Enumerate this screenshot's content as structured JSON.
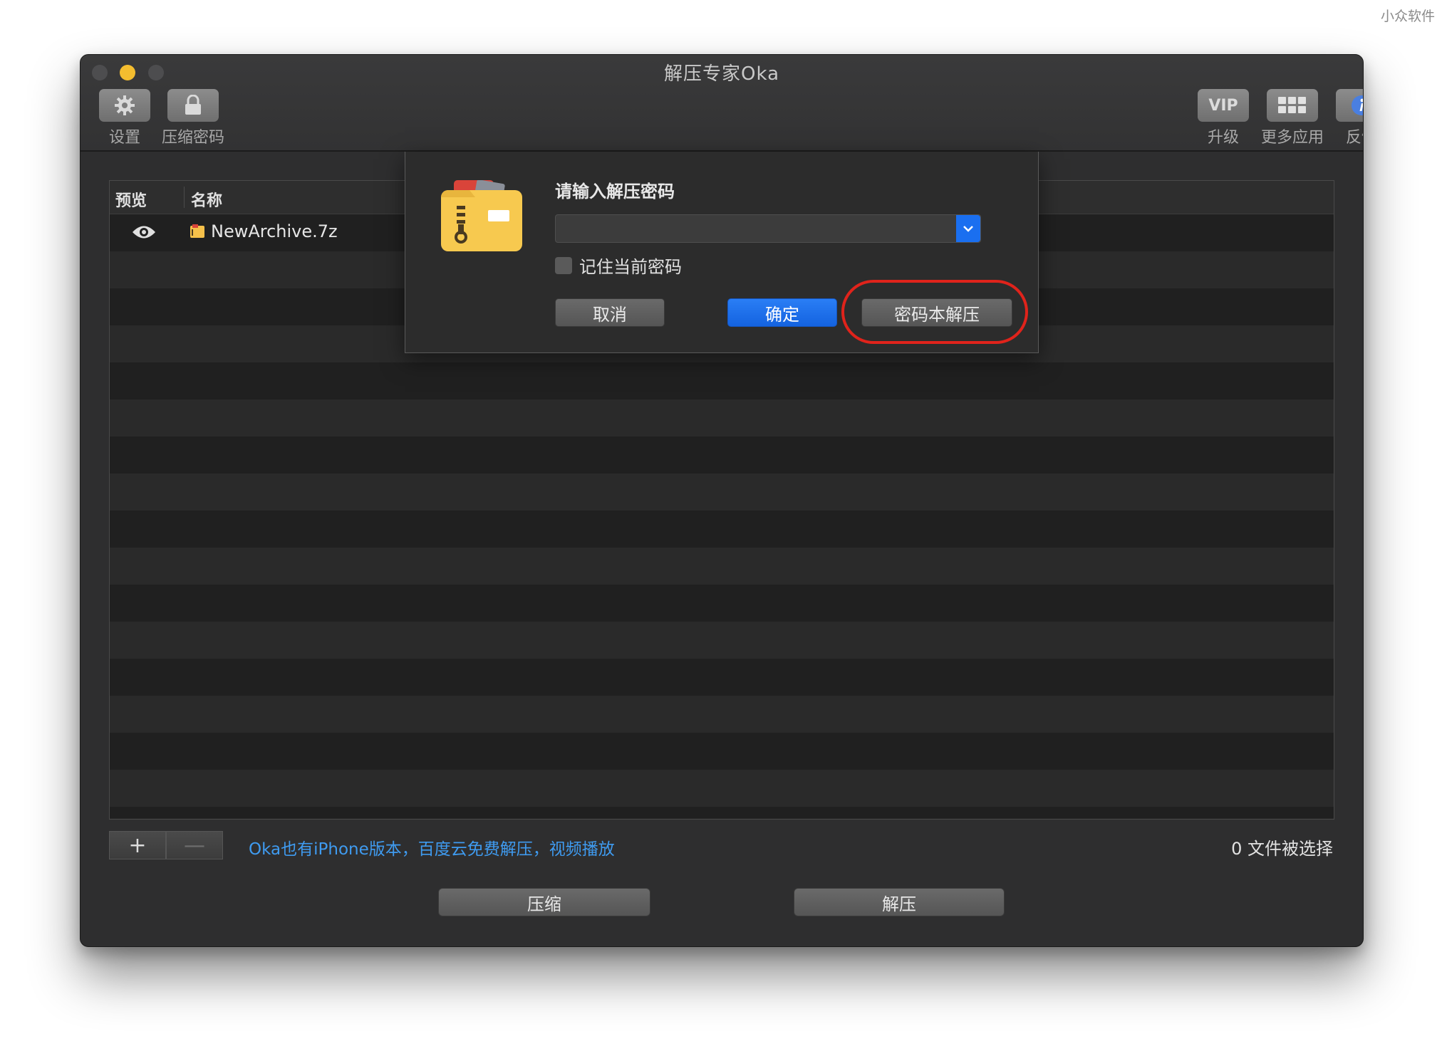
{
  "watermark": "小众软件",
  "window": {
    "title": "解压专家Oka"
  },
  "toolbar": {
    "left": [
      {
        "label": "设置",
        "icon": "gear-icon"
      },
      {
        "label": "压缩密码",
        "icon": "lock-icon"
      }
    ],
    "right": [
      {
        "label": "升级",
        "icon": "vip-icon",
        "icon_text": "VIP"
      },
      {
        "label": "更多应用",
        "icon": "grid-icon"
      },
      {
        "label": "反馈",
        "icon": "info-icon"
      }
    ]
  },
  "table": {
    "columns": [
      "预览",
      "名称"
    ],
    "rows": [
      {
        "preview_icon": "eye-icon",
        "file_icon": "archive-icon",
        "name": "NewArchive.7z"
      }
    ]
  },
  "footer": {
    "add_label": "+",
    "remove_label": "—",
    "promo_text": "Oka也有iPhone版本，百度云免费解压，视频播放",
    "selection_status": "0 文件被选择",
    "compress_label": "压缩",
    "extract_label": "解压"
  },
  "dialog": {
    "title": "请输入解压密码",
    "password_value": "",
    "remember_label": "记住当前密码",
    "remember_checked": false,
    "cancel_label": "取消",
    "ok_label": "确定",
    "password_book_label": "密码本解压"
  },
  "colors": {
    "accent_blue": "#1a6ff0",
    "link_blue": "#3f9bf0",
    "highlight_red": "#e0231b",
    "window_bg": "#2e2e2f"
  }
}
